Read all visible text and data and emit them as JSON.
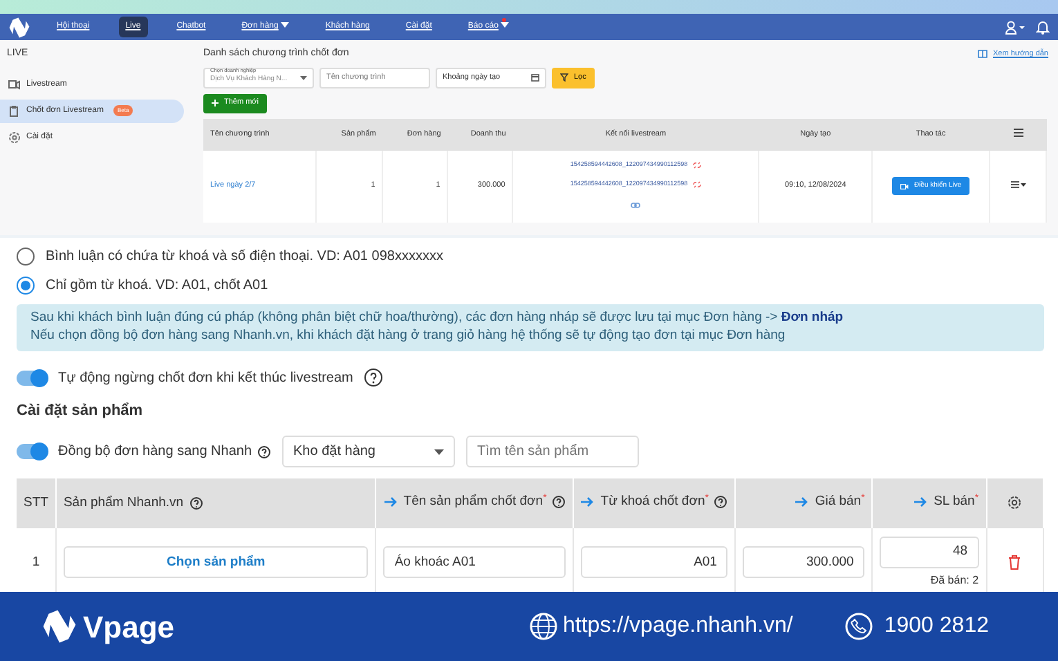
{
  "nav": {
    "items": [
      {
        "label": "Hội thoại",
        "selected": false,
        "caret": false,
        "dot": false
      },
      {
        "label": "Live",
        "selected": true,
        "caret": false,
        "dot": false
      },
      {
        "label": "Chatbot",
        "selected": false,
        "caret": false,
        "dot": false
      },
      {
        "label": "Đơn hàng",
        "selected": false,
        "caret": true,
        "dot": false
      },
      {
        "label": "Khách hàng",
        "selected": false,
        "caret": false,
        "dot": false
      },
      {
        "label": "Cài đặt",
        "selected": false,
        "caret": false,
        "dot": false
      },
      {
        "label": "Báo cáo",
        "selected": false,
        "caret": true,
        "dot": true
      }
    ]
  },
  "sidebar": {
    "title": "LIVE",
    "items": [
      {
        "label": "Livestream",
        "kind": "video",
        "selected": false
      },
      {
        "label": "Chốt đơn Livestream",
        "kind": "clipboard",
        "selected": true,
        "badge": "Beta"
      },
      {
        "label": "Cài đặt",
        "kind": "gear",
        "selected": false
      }
    ]
  },
  "page": {
    "title": "Danh sách chương trình chốt đơn",
    "guide_link": "Xem hướng dẫn",
    "filters": {
      "company_label": "Chọn doanh nghiệp",
      "company_value": "Dịch Vụ Khách Hàng N...",
      "name_placeholder": "Tên chương trình",
      "date_placeholder": "Khoảng ngày tạo",
      "filter_button": "Lọc"
    },
    "add_button": "Thêm mới"
  },
  "orders_table": {
    "columns": [
      "Tên chương trình",
      "Sản phẩm",
      "Đơn hàng",
      "Doanh thu",
      "Kết nối livestream",
      "Ngày tạo",
      "Thao tác"
    ],
    "rows": [
      {
        "name": "Live ngày 2/7",
        "products": "1",
        "orders": "1",
        "revenue": "300.000",
        "links": [
          "154258594442608_122097434990112598",
          "154258594442608_122097434990112598"
        ],
        "created": "09:10, 12/08/2024",
        "action": "Điều khiển Live"
      }
    ]
  },
  "options": [
    {
      "label": "Bình luận có chứa từ khoá và số điện thoại. VD: A01 098xxxxxxx",
      "selected": false
    },
    {
      "label": "Chỉ gồm từ khoá. VD: A01, chốt A01",
      "selected": true
    }
  ],
  "notice": {
    "lines": [
      "Sau khi khách bình luận đúng cú pháp (không phân biệt chữ hoa/thường), các đơn hàng nháp sẽ được lưu tại mục Đơn hàng -> **Đơn nháp**",
      "Nếu chọn đồng bộ đơn hàng sang Nhanh.vn, khi khách đặt hàng ở trang giỏ hàng hệ thống sẽ tự động tạo đơn tại mục Đơn hàng"
    ]
  },
  "auto_stop": {
    "label": "Tự động ngừng chốt đơn khi kết thúc livestream",
    "on": true
  },
  "product_settings": {
    "title": "Cài đặt sản phẩm",
    "sync": {
      "label": "Đồng bộ đơn hàng sang Nhanh",
      "on": true
    },
    "warehouse": "Kho đặt hàng",
    "search_placeholder": "Tìm tên sản phẩm",
    "columns": [
      {
        "label": "STT",
        "arrow": false,
        "help": false
      },
      {
        "label": "Sản phẩm Nhanh.vn",
        "arrow": false,
        "help": true
      },
      {
        "label": "Tên sản phẩm chốt đơn",
        "arrow": true,
        "required_mark": "*",
        "help": true
      },
      {
        "label": "Từ khoá chốt đơn",
        "arrow": true,
        "required_mark": "*",
        "help": true
      },
      {
        "label": "Giá bán",
        "arrow": true,
        "required_mark": "*",
        "help": false
      },
      {
        "label": "SL bán",
        "arrow": true,
        "required_mark": "*",
        "help": false
      }
    ],
    "rows": [
      {
        "stt": "1",
        "pick_button": "Chọn sản phẩm",
        "name": "Áo khoác A01",
        "keyword": "A01",
        "price": "300.000",
        "quantity": "48",
        "sold": "Đã bán: 2"
      }
    ]
  },
  "footer": {
    "brand": "Vpage",
    "url": "https://vpage.nhanh.vn/",
    "phone": "1900 2812"
  }
}
